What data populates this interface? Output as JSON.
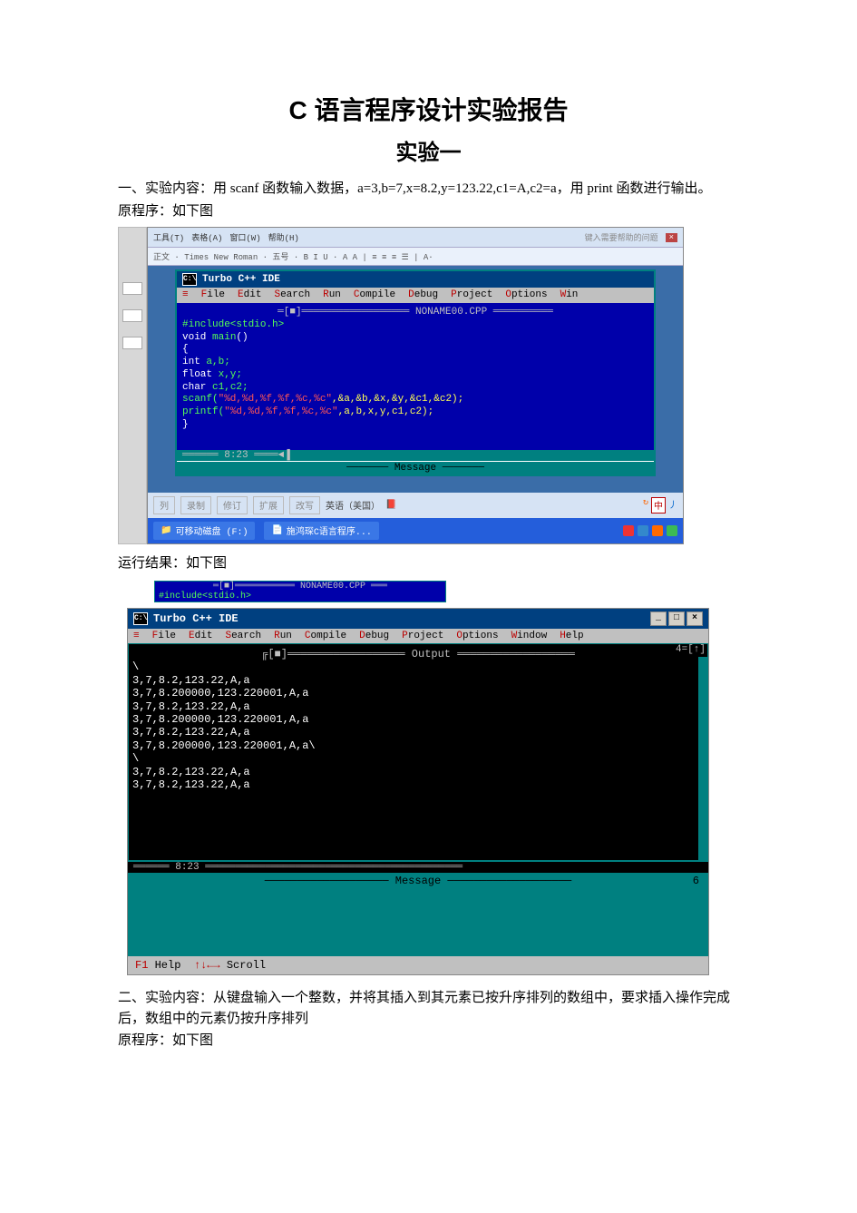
{
  "doc": {
    "title": "C 语言程序设计实验报告",
    "subtitle": "实验一",
    "para1": "一、实验内容：用 scanf 函数输入数据，a=3,b=7,x=8.2,y=123.22,c1=A,c2=a，用 print 函数进行输出。",
    "para1b": "原程序：如下图",
    "result_label": "运行结果：如下图",
    "para2": "二、实验内容：从键盘输入一个整数，并将其插入到其元素已按升序排列的数组中，要求插入操作完成后，数组中的元素仍按升序排列",
    "para2b": "原程序：如下图"
  },
  "word_toolbar": {
    "items": [
      "工具(T)",
      "表格(A)",
      "窗口(W)",
      "帮助(H)"
    ],
    "right_hint": "键入需要帮助的问题"
  },
  "word_fmt": "正文  · Times New Roman · 五号 · B I U · A A | ≡ ≡ ≡ ☰ | A·",
  "tc": {
    "app": "Turbo C++ IDE",
    "menus": [
      "File",
      "Edit",
      "Search",
      "Run",
      "Compile",
      "Debug",
      "Project",
      "Options",
      "Win"
    ],
    "filename": "NONAME00.CPP",
    "code": [
      "#include<stdio.h>",
      "void main()",
      "{",
      "int a,b;",
      "float x,y;",
      "char c1,c2;",
      "scanf(\"%d,%d,%f,%f,%c,%c\",&a,&b,&x,&y,&c1,&c2);",
      "printf(\"%d,%d,%f,%f,%c,%c\",a,b,x,y,c1,c2);",
      "}"
    ],
    "pos": "8:23",
    "message": "Message"
  },
  "statusbar1": {
    "items": [
      "列",
      "录制",
      "修订",
      "扩展",
      "改写"
    ],
    "lang": "英语（美国）"
  },
  "taskbar": {
    "disk": "可移动磁盘 (F:)",
    "doc": "施鸿琛C语言程序..."
  },
  "frag": {
    "fname": "NONAME00.CPP",
    "line": "#include<stdio.h>"
  },
  "tc2": {
    "app": "Turbo C++ IDE",
    "menus": [
      "File",
      "Edit",
      "Search",
      "Run",
      "Compile",
      "Debug",
      "Project",
      "Options",
      "Window",
      "Help"
    ],
    "pane_title": "Output",
    "badge": "4=[↑]",
    "output": [
      "\\",
      "3,7,8.2,123.22,A,a",
      "3,7,8.200000,123.220001,A,a",
      "3,7,8.2,123.22,A,a",
      "3,7,8.200000,123.220001,A,a",
      "3,7,8.2,123.22,A,a",
      "3,7,8.200000,123.220001,A,a\\",
      "               \\",
      "",
      "3,7,8.2,123.22,A,a",
      "3,7,8.2,123.22,A,a"
    ],
    "pos": "8:23",
    "message": "Message",
    "msg_right": "6",
    "fkey": "F1 Help  ↑↓←→ Scroll"
  }
}
